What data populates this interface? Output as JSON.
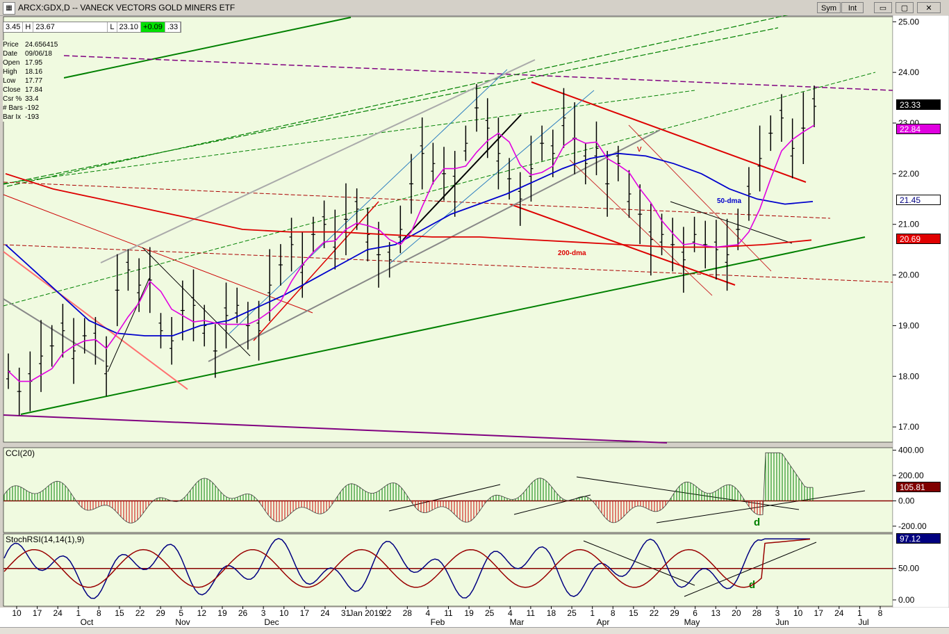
{
  "window": {
    "icon": "chart-icon",
    "title": "ARCX:GDX,D -- VANECK VECTORS GOLD MINERS ETF",
    "buttons": [
      {
        "name": "sym-link-button",
        "label": "Sym"
      },
      {
        "name": "int-link-button",
        "label": "Int"
      },
      {
        "name": "minimize-button",
        "label": "▭"
      },
      {
        "name": "restore-button",
        "label": "▢"
      },
      {
        "name": "close-button",
        "label": "✕"
      }
    ]
  },
  "quote_bar": {
    "open": "3.45",
    "high_label": "H",
    "high": "23.67",
    "low_label": "L",
    "low": "23.10",
    "change": "+0.09",
    "last": ".33"
  },
  "info_box": [
    {
      "k": "Price",
      "v": "24.656415"
    },
    {
      "k": "Date",
      "v": "09/06/18"
    },
    {
      "k": "Open",
      "v": "17.95"
    },
    {
      "k": "High",
      "v": "18.16"
    },
    {
      "k": "Low",
      "v": "17.77"
    },
    {
      "k": "Close",
      "v": "17.84"
    },
    {
      "k": "Csr %",
      "v": "33.4"
    },
    {
      "k": "# Bars",
      "v": "-192"
    },
    {
      "k": "Bar Ix",
      "v": "-193"
    }
  ],
  "price_tags": [
    {
      "name": "last-price-tag",
      "value": "23.33",
      "bg": "#000000",
      "fg": "#ffffff",
      "y": 150
    },
    {
      "name": "stoch-ma-price-tag",
      "value": "22.84",
      "bg": "#e000e0",
      "fg": "#ffffff",
      "y": 185
    },
    {
      "name": "dma50-price-tag",
      "value": "21.45",
      "bg": "#ffffff",
      "fg": "#000080",
      "y": 287
    },
    {
      "name": "dma200-price-tag",
      "value": "20.69",
      "bg": "#e00000",
      "fg": "#ffffff",
      "y": 343
    }
  ],
  "cci_tag": {
    "value": "105.81"
  },
  "stoch_tag": {
    "value": "97.12"
  },
  "annotations": {
    "dma50": "50-dma",
    "dma200": "200-dma",
    "d1": "d",
    "d2": "d",
    "v": "v"
  },
  "colors": {
    "bg": "#f0fae0",
    "price_bar": "#000000",
    "dma50": "#0000cc",
    "dma200": "#dd0000",
    "fast_ma": "#e000e0",
    "green_line": "#008000",
    "purple_line": "#800080",
    "cci_pos": "#008000",
    "cci_neg": "#cc0000",
    "stoch_k": "#000080",
    "stoch_d": "#990000"
  },
  "chart_data": [
    {
      "type": "ohlc",
      "title": "ARCX:GDX,D -- VANECK VECTORS GOLD MINERS ETF",
      "ylim": [
        16.7,
        25.1
      ],
      "yticks": [
        "25.00",
        "24.00",
        "23.00",
        "22.00",
        "21.00",
        "20.00",
        "19.00",
        "18.00",
        "17.00"
      ],
      "ytick_values": [
        25,
        24,
        23,
        22,
        21,
        20,
        19,
        18,
        17
      ],
      "x_labels": [
        "10",
        "17",
        "24",
        "1",
        "8",
        "15",
        "22",
        "29",
        "5",
        "12",
        "19",
        "26",
        "3",
        "10",
        "17",
        "24",
        "31",
        "Jan 2019",
        "22",
        "28",
        "4",
        "11",
        "19",
        "25",
        "4",
        "11",
        "18",
        "25",
        "1",
        "8",
        "15",
        "22",
        "29",
        "6",
        "13",
        "20",
        "28",
        "3",
        "10",
        "17",
        "24",
        "1",
        "8"
      ],
      "month_labels": [
        "Oct",
        "Nov",
        "Dec",
        "Feb",
        "Mar",
        "Apr",
        "May",
        "Jun",
        "Jul"
      ],
      "series": [
        {
          "name": "50-dma",
          "values": [
            20.6,
            20.1,
            19.6,
            19.1,
            18.85,
            18.8,
            18.8,
            19.0,
            19.1,
            19.35,
            19.6,
            19.9,
            20.2,
            20.5,
            20.6,
            20.9,
            21.2,
            21.4,
            21.6,
            21.85,
            22.1,
            22.3,
            22.4,
            22.35,
            22.2,
            22.0,
            21.7,
            21.5,
            21.4,
            21.45
          ]
        },
        {
          "name": "200-dma",
          "values": [
            22.0,
            21.7,
            21.5,
            21.3,
            21.1,
            20.9,
            20.85,
            20.85,
            20.8,
            20.75,
            20.75,
            20.7,
            20.65,
            20.6,
            20.55,
            20.55,
            20.6,
            20.69
          ]
        }
      ],
      "closes": [
        18.1,
        17.7,
        17.9,
        18.4,
        18.6,
        18.9,
        18.5,
        18.8,
        18.7,
        18.2,
        19.7,
        20.1,
        19.8,
        19.9,
        18.9,
        18.7,
        19.3,
        19.4,
        19.0,
        18.5,
        19.2,
        19.4,
        19.0,
        18.9,
        19.8,
        20.2,
        20.6,
        20.2,
        20.8,
        21.0,
        20.7,
        21.1,
        21.3,
        20.8,
        20.4,
        20.3,
        20.9,
        21.8,
        22.4,
        22.2,
        22.0,
        21.8,
        22.6,
        23.3,
        22.9,
        22.4,
        21.9,
        21.5,
        22.1,
        22.6,
        22.4,
        23.1,
        22.7,
        22.2,
        22.5,
        21.8,
        22.2,
        21.6,
        21.2,
        20.7,
        20.8,
        20.6,
        20.3,
        20.8,
        20.6,
        20.5,
        20.4,
        20.9,
        21.6,
        22.3,
        22.8,
        23.1,
        22.5,
        22.9,
        23.33
      ]
    },
    {
      "type": "bar",
      "title": "CCI(20)",
      "ylim": [
        -250,
        420
      ],
      "yticks": [
        "400.00",
        "200.00",
        "0.00",
        "-200.00"
      ],
      "ytick_values": [
        400,
        200,
        0,
        -200
      ],
      "last": 105.81
    },
    {
      "type": "line",
      "title": "StochRSI(14,14(1),9)",
      "ylim": [
        -10,
        105
      ],
      "yticks": [
        "50.00",
        "0.00"
      ],
      "ytick_values": [
        50,
        0
      ],
      "last": 97.12
    }
  ]
}
